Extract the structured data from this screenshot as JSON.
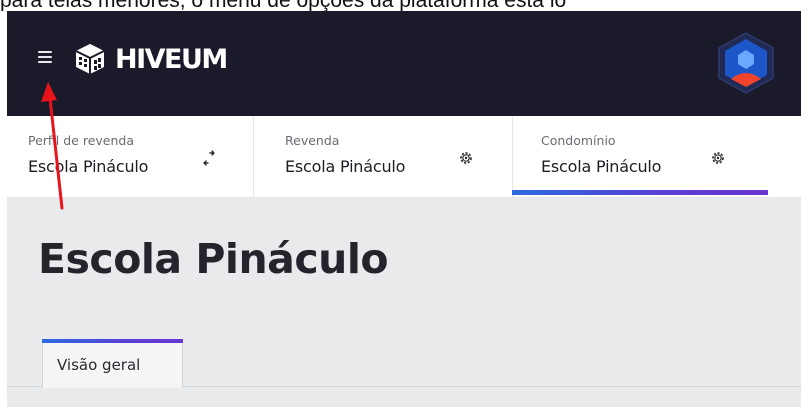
{
  "caption": "para telas menores, o menu de opções da plataforma está lo",
  "brand": {
    "name": "HIVEUM"
  },
  "colors": {
    "topbar": "#1a1a2b",
    "accent_start": "#2c6be0",
    "accent_end": "#6a35d0",
    "annotation_arrow": "#e8131b",
    "avatar": "#1d56c9"
  },
  "icons": {
    "menu": "hamburger-icon",
    "swap": "swap-arrows-icon",
    "settings": "gear-icon",
    "user": "user-avatar-icon"
  },
  "context_tabs": [
    {
      "label": "Perfil de revenda",
      "value": "Escola Pináculo",
      "icon": "swap-arrows-icon"
    },
    {
      "label": "Revenda",
      "value": "Escola Pináculo",
      "icon": "gear-icon"
    },
    {
      "label": "Condomínio",
      "value": "Escola Pináculo",
      "icon": "gear-icon",
      "active": true
    }
  ],
  "page": {
    "title": "Escola Pináculo"
  },
  "tabs": [
    {
      "label": "Visão geral",
      "active": true
    }
  ]
}
